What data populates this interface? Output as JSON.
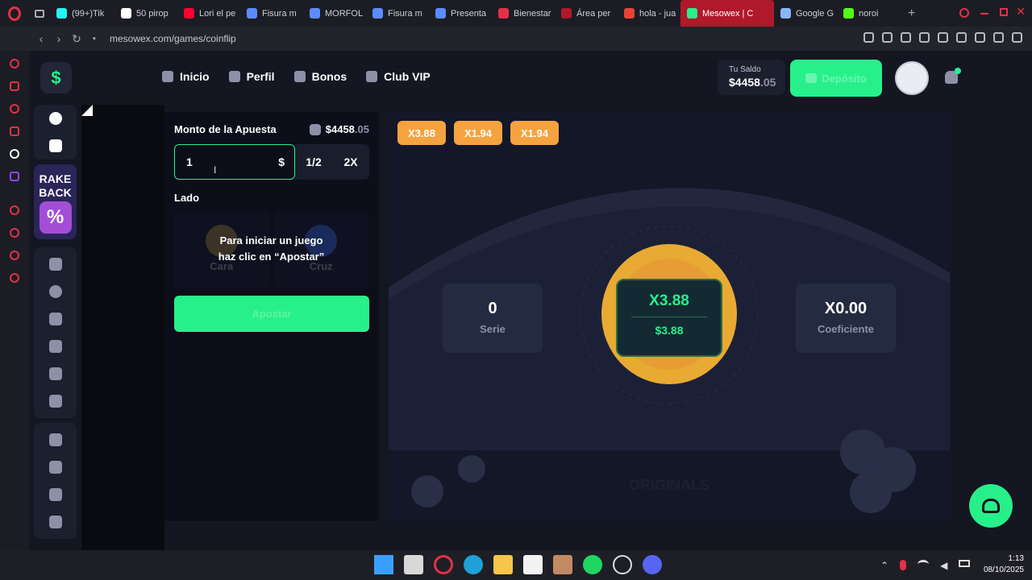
{
  "browser": {
    "tabs": [
      {
        "label": "(99+)Tik",
        "color": "#25f4ee"
      },
      {
        "label": "50 pirop",
        "color": "#ffffff"
      },
      {
        "label": "Lori el pe",
        "color": "#ff0033"
      },
      {
        "label": "Fisura m",
        "color": "#5b8cff"
      },
      {
        "label": "MORFOL",
        "color": "#5b8cff"
      },
      {
        "label": "Fisura m",
        "color": "#5b8cff"
      },
      {
        "label": "Presenta",
        "color": "#5b8cff"
      },
      {
        "label": "Bienestar",
        "color": "#e23147"
      },
      {
        "label": "Área per",
        "color": "#b0182b"
      },
      {
        "label": "hola - jua",
        "color": "#ea4335"
      },
      {
        "label": "Mesowex | C",
        "color": "#27f08b",
        "active": true
      },
      {
        "label": "Google G",
        "color": "#8ab4f8"
      },
      {
        "label": "noroi",
        "color": "#53fc18"
      }
    ],
    "url": "mesowex.com/games/coinflip"
  },
  "nav": {
    "items": [
      "Inicio",
      "Perfil",
      "Bonos",
      "Club VIP"
    ],
    "balance_label": "Tu Saldo",
    "balance_main": "$4458",
    "balance_dec": ".05",
    "deposit_label": "Depósito"
  },
  "sidebar": {
    "rake_line1": "RAKE",
    "rake_line2": "BACK",
    "rake_icon": "%"
  },
  "bet_panel": {
    "title": "Monto de la Apuesta",
    "balance_main": "$4458",
    "balance_dec": ".05",
    "input_value": "1",
    "currency": "$",
    "half_label": "1/2",
    "double_label": "2X",
    "side_label": "Lado",
    "side_heads": "Cara",
    "side_tails": "Cruz",
    "hint_line1": "Para iniciar un juego",
    "hint_line2": "haz clic en “Apostar”",
    "bet_button": "Apostar"
  },
  "game": {
    "history": [
      "X3.88",
      "X1.94",
      "X1.94"
    ],
    "streak_value": "0",
    "streak_label": "Serie",
    "coef_value": "X0.00",
    "coef_label": "Coeficiente",
    "multiplier": "X3.88",
    "win_amount": "$3.88",
    "watermark": "ORIGINALS"
  },
  "system": {
    "time": "1:13",
    "date": "08/10/2025"
  }
}
